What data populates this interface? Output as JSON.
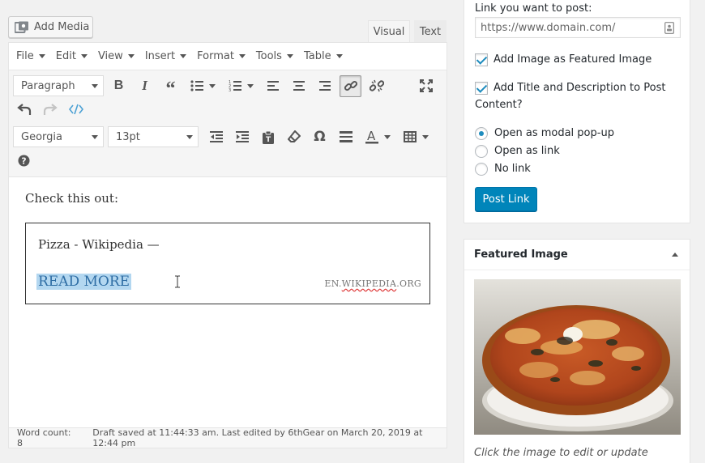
{
  "editor": {
    "add_media_label": "Add Media",
    "tabs": [
      {
        "label": "Visual"
      },
      {
        "label": "Text"
      }
    ],
    "menu": [
      {
        "label": "File"
      },
      {
        "label": "Edit"
      },
      {
        "label": "View"
      },
      {
        "label": "Insert"
      },
      {
        "label": "Format"
      },
      {
        "label": "Tools"
      },
      {
        "label": "Table"
      }
    ],
    "block_format": "Paragraph",
    "font_family": "Georgia",
    "font_size": "13pt",
    "content": {
      "intro": "Check this out:",
      "card_title": "Pizza - Wikipedia —",
      "read_more": "READ MORE",
      "domain_prefix": "EN.",
      "domain_squiggle": "WIKIPEDIA",
      "domain_suffix": ".ORG"
    },
    "status": {
      "word_count": "Word count: 8",
      "draft_saved": "Draft saved at 11:44:33 am. Last edited by 6thGear on March 20, 2019 at 12:44 pm"
    }
  },
  "sidebar": {
    "link_label": "Link you want to post:",
    "link_placeholder": "https://www.domain.com/",
    "options": [
      {
        "label": "Add Image as Featured Image",
        "checked": true
      },
      {
        "label_line1": "Add Title and Description to Post",
        "label_line2": "Content?",
        "checked": true
      }
    ],
    "radios": [
      {
        "label": "Open as modal pop-up",
        "selected": true
      },
      {
        "label": "Open as link",
        "selected": false
      },
      {
        "label": "No link",
        "selected": false
      }
    ],
    "post_button": "Post Link",
    "featured_image": {
      "title": "Featured Image",
      "caption": "Click the image to edit or update"
    }
  },
  "colors": {
    "primary_button": "#0085ba",
    "checkbox_accent": "#1e8cbe",
    "selection": "#b3d7f0"
  }
}
